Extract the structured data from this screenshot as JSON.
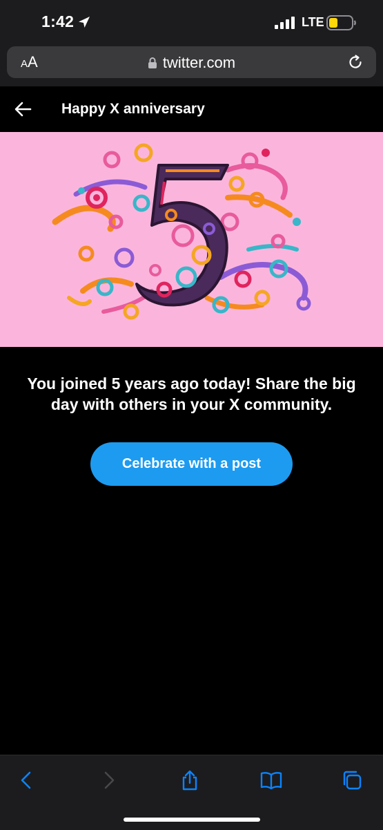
{
  "status_bar": {
    "time": "1:42",
    "network": "LTE",
    "battery_color": "#ffd60a"
  },
  "browser": {
    "text_size_big": "A",
    "text_size_small": "A",
    "url": "twitter.com",
    "icons": {
      "lock": "lock-icon",
      "reload": "reload-icon"
    }
  },
  "header": {
    "title": "Happy X anniversary",
    "back_icon": "arrow-left-icon"
  },
  "hero": {
    "digit": "5",
    "background_color": "#fbb5dd"
  },
  "main": {
    "message": "You joined 5 years ago today! Share the big day with others in your X community.",
    "cta_label": "Celebrate with a post",
    "cta_color": "#1d9bf0"
  },
  "toolbar": {
    "icons": [
      "chevron-left-icon",
      "chevron-right-icon",
      "share-icon",
      "bookmarks-icon",
      "tabs-icon"
    ],
    "accent_color": "#0a84ff"
  }
}
